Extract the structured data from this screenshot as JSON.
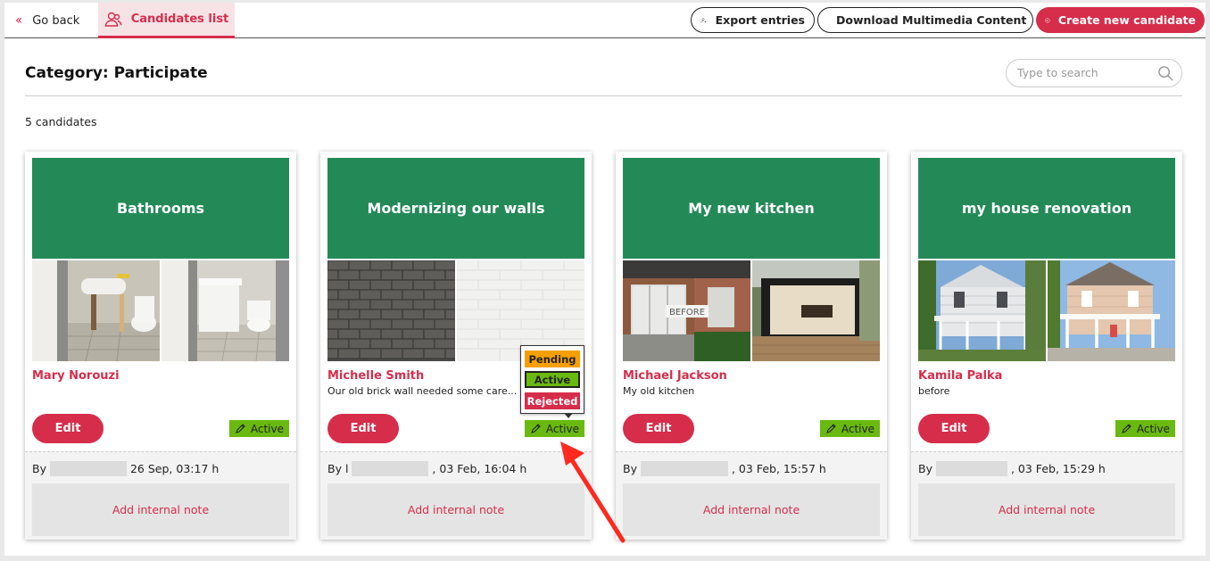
{
  "topbar": {
    "go_back": "Go back",
    "tab_label": "Candidates list",
    "export_label": "Export entries",
    "download_label": "Download Multimedia Content",
    "create_label": "Create new candidate"
  },
  "page": {
    "title": "Category: Participate",
    "search_placeholder": "Type to search",
    "count": "5 candidates"
  },
  "colors": {
    "brand": "#d62d4b",
    "card_header": "#238a57",
    "active": "#6ab910",
    "pending": "#f5a000"
  },
  "cards": [
    {
      "title": "Bathrooms",
      "name": "Mary Norouzi",
      "desc": "",
      "edit": "Edit",
      "status": "Active",
      "by": "By",
      "date": "26 Sep, 03:17 h",
      "note": "Add internal note"
    },
    {
      "title": "Modernizing our walls",
      "name": "Michelle Smith",
      "desc": "Our old brick wall needed some care...",
      "edit": "Edit",
      "status": "Active",
      "by": "By l",
      "date": ", 03 Feb, 16:04 h",
      "note": "Add internal note"
    },
    {
      "title": "My new kitchen",
      "name": "Michael Jackson",
      "desc": "My old kitchen",
      "edit": "Edit",
      "status": "Active",
      "by": "By",
      "date": ", 03 Feb, 15:57 h",
      "note": "Add internal note",
      "photo_label": "BEFORE"
    },
    {
      "title": "my house renovation",
      "name": "Kamila Palka",
      "desc": "before",
      "edit": "Edit",
      "status": "Active",
      "by": "By",
      "date": ", 03 Feb, 15:29 h",
      "note": "Add internal note"
    }
  ],
  "dropdown": {
    "pending": "Pending",
    "active": "Active",
    "rejected": "Rejected"
  }
}
